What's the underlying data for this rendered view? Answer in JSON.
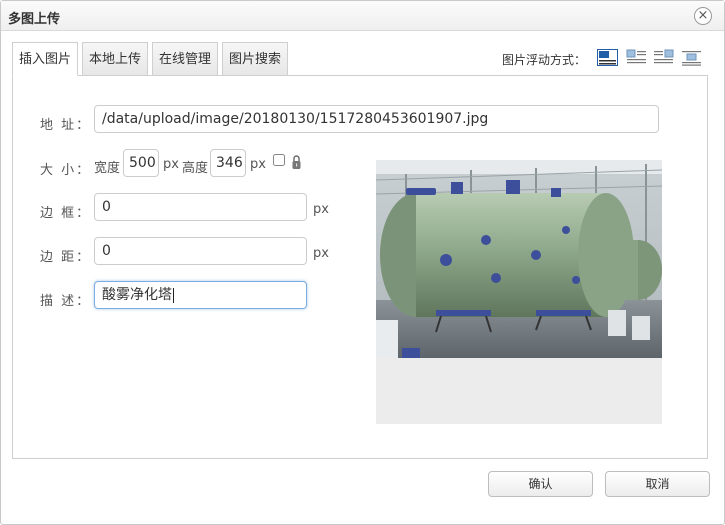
{
  "dialog": {
    "title": "多图上传",
    "close_label": "×"
  },
  "tabs": [
    {
      "label": "插入图片",
      "active": true
    },
    {
      "label": "本地上传",
      "active": false
    },
    {
      "label": "在线管理",
      "active": false
    },
    {
      "label": "图片搜索",
      "active": false
    }
  ],
  "float": {
    "label": "图片浮动方式：",
    "icons": [
      "float-none-icon",
      "float-left-icon",
      "float-right-icon",
      "float-center-icon"
    ]
  },
  "form": {
    "address_label": "地 址：",
    "address_value": "/data/upload/image/20180130/1517280453601907.jpg",
    "size_label": "大 小：",
    "width_label": "宽度",
    "width_value": "500",
    "height_label": "高度",
    "height_value": "346",
    "px": "px",
    "border_label": "边 框：",
    "border_value": "0",
    "spacing_label": "边 距：",
    "spacing_value": "0",
    "desc_label": "描 述：",
    "desc_value": "酸雾净化塔"
  },
  "buttons": {
    "confirm": "确认",
    "cancel": "取消"
  },
  "colors": {
    "tank_green": "#8fa98c",
    "focus_border": "#7aaee0",
    "float_active": "#1e5fa8"
  }
}
